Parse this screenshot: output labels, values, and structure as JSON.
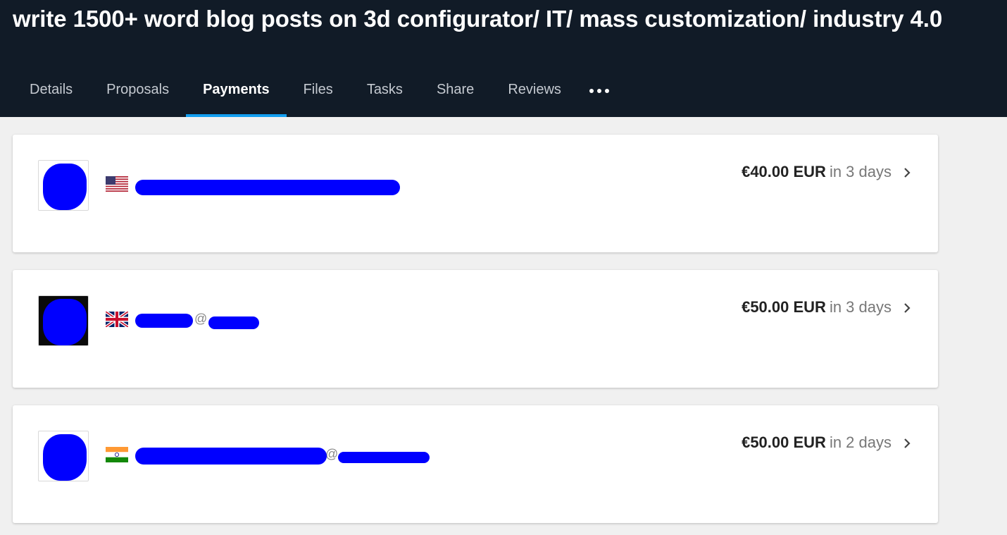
{
  "header": {
    "title": "write 1500+ word blog posts on 3d configurator/ IT/ mass customization/ industry 4.0"
  },
  "tabs": [
    {
      "label": "Details",
      "active": false
    },
    {
      "label": "Proposals",
      "active": false
    },
    {
      "label": "Payments",
      "active": true
    },
    {
      "label": "Files",
      "active": false
    },
    {
      "label": "Tasks",
      "active": false
    },
    {
      "label": "Share",
      "active": false
    },
    {
      "label": "Reviews",
      "active": false
    }
  ],
  "more_icon": "ellipsis-icon",
  "payments": [
    {
      "flag": "us-flag-icon",
      "name": "",
      "handle": "",
      "amount": "€40.00 EUR",
      "due": "in 3 days"
    },
    {
      "flag": "uk-flag-icon",
      "name": "",
      "handle": "@",
      "amount": "€50.00 EUR",
      "due": "in 3 days"
    },
    {
      "flag": "india-flag-icon",
      "name": "",
      "handle": "@",
      "amount": "€50.00 EUR",
      "due": "in 2 days"
    }
  ],
  "colors": {
    "header_bg": "#111b27",
    "active_tab_underline": "#139ff0",
    "redaction": "#0000ff"
  }
}
